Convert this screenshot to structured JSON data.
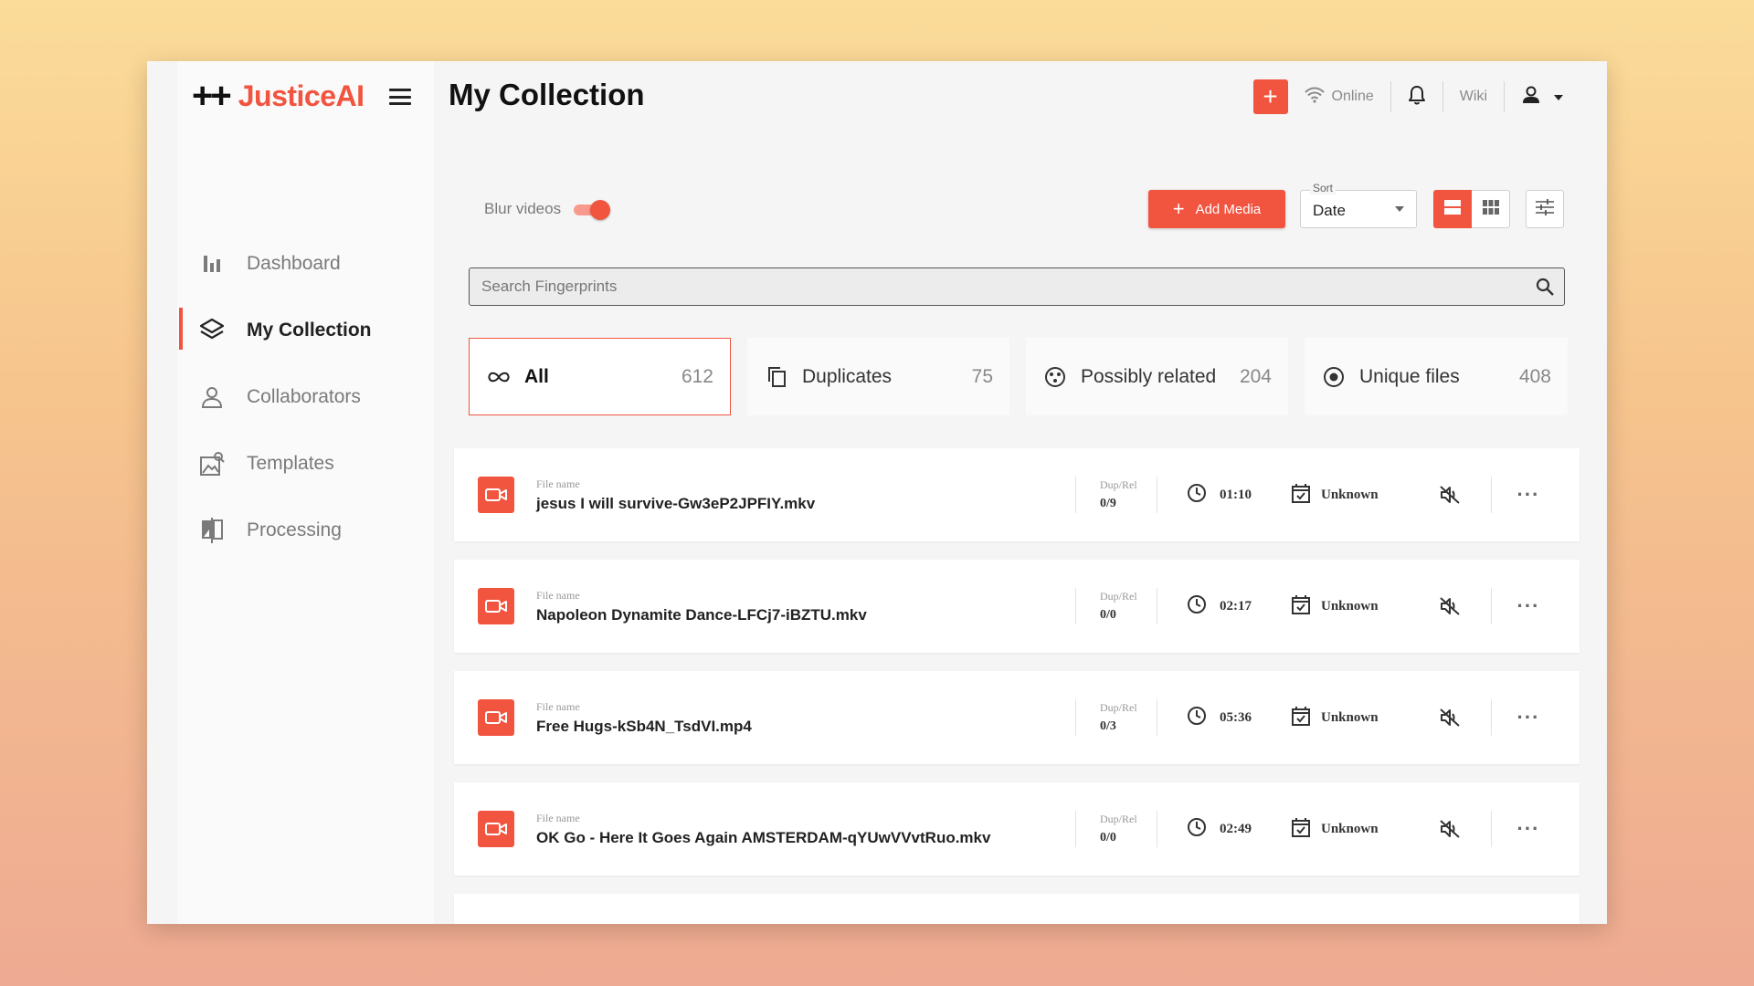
{
  "app": {
    "logo_symbol": "++",
    "brand": "JusticeAI",
    "accent_color": "#f1543f"
  },
  "sidebar": {
    "items": [
      {
        "label": "Dashboard",
        "icon": "bar-chart-icon",
        "active": false
      },
      {
        "label": "My Collection",
        "icon": "layers-icon",
        "active": true
      },
      {
        "label": "Collaborators",
        "icon": "person-icon",
        "active": false
      },
      {
        "label": "Templates",
        "icon": "image-template-icon",
        "active": false
      },
      {
        "label": "Processing",
        "icon": "compare-icon",
        "active": false
      }
    ]
  },
  "header": {
    "title": "My Collection",
    "status": "Online",
    "wiki": "Wiki"
  },
  "controls": {
    "blur_label": "Blur videos",
    "blur_enabled": true,
    "add_media": "Add Media",
    "sort_label": "Sort",
    "sort_value": "Date",
    "view_mode": "list"
  },
  "search": {
    "placeholder": "Search Fingerprints",
    "value": ""
  },
  "categories": [
    {
      "label": "All",
      "count": "612",
      "icon": "infinity-icon",
      "active": true
    },
    {
      "label": "Duplicates",
      "count": "75",
      "icon": "copy-icon",
      "active": false
    },
    {
      "label": "Possibly related",
      "count": "204",
      "icon": "related-icon",
      "active": false
    },
    {
      "label": "Unique files",
      "count": "408",
      "icon": "unique-icon",
      "active": false
    }
  ],
  "files": {
    "name_caption": "File name",
    "duprel_caption": "Dup/Rel",
    "rows": [
      {
        "name": "jesus I will survive-Gw3eP2JPFIY.mkv",
        "duprel": "0/9",
        "duration": "01:10",
        "date": "Unknown"
      },
      {
        "name": "Napoleon Dynamite Dance-LFCj7-iBZTU.mkv",
        "duprel": "0/0",
        "duration": "02:17",
        "date": "Unknown"
      },
      {
        "name": "Free Hugs-kSb4N_TsdVI.mp4",
        "duprel": "0/3",
        "duration": "05:36",
        "date": "Unknown"
      },
      {
        "name": "OK Go - Here It Goes Again AMSTERDAM-qYUwVVvtRuo.mkv",
        "duprel": "0/0",
        "duration": "02:49",
        "date": "Unknown"
      }
    ]
  }
}
